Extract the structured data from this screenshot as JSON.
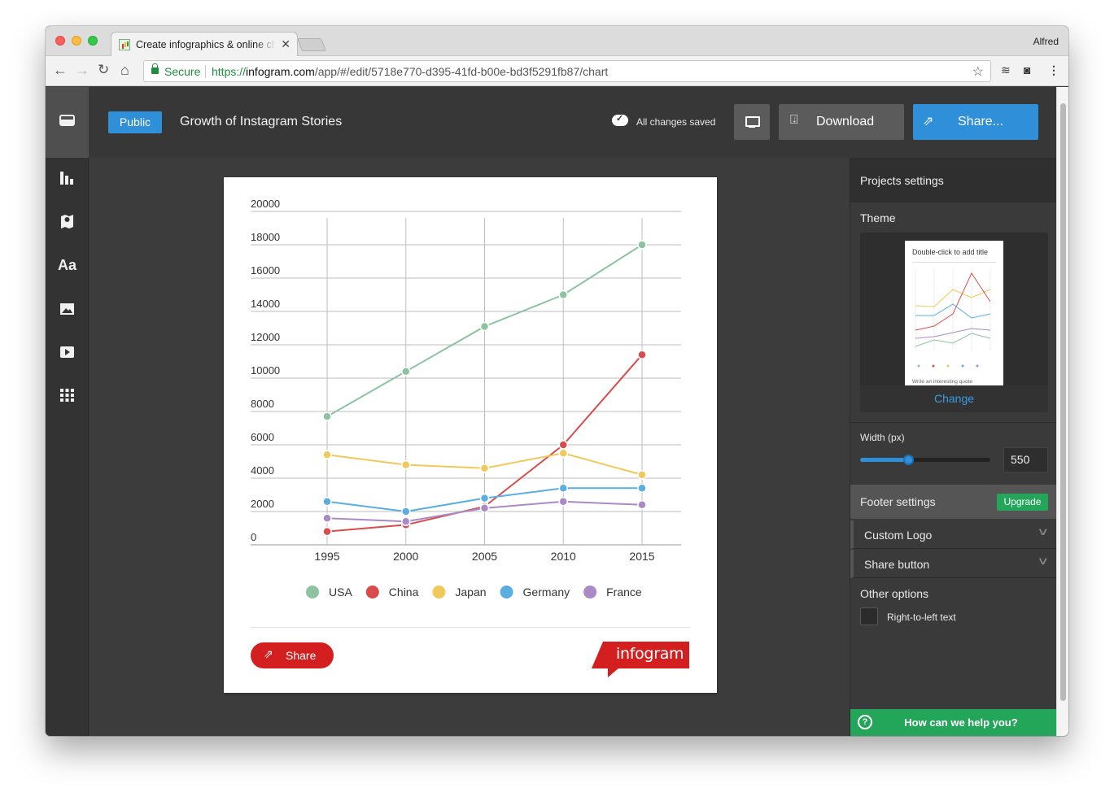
{
  "browser": {
    "tab_title": "Create infographics & online charts",
    "profile": "Alfred",
    "secure_label": "Secure",
    "url_scheme": "https://",
    "url_host": "infogram.com",
    "url_path": "/app/#/edit/5718e770-d395-41fd-b00e-bd3f5291fb87/chart"
  },
  "topbar": {
    "visibility_badge": "Public",
    "title": "Growth of Instagram Stories",
    "save_status": "All changes saved",
    "download_label": "Download",
    "share_label": "Share..."
  },
  "left_rail": {
    "icons": [
      "library-icon",
      "chart-icon",
      "map-icon",
      "text-icon",
      "image-icon",
      "video-icon",
      "grid-icon"
    ]
  },
  "card": {
    "share_label": "Share",
    "brand": "infogram"
  },
  "chart_data": {
    "type": "line",
    "title": "",
    "xlabel": "",
    "ylabel": "",
    "x": [
      1995,
      2000,
      2005,
      2010,
      2015
    ],
    "x_labels": [
      "1995",
      "2000",
      "2005",
      "2010",
      "2015"
    ],
    "ylim": [
      0,
      20000
    ],
    "yticks": [
      0,
      2000,
      4000,
      6000,
      8000,
      10000,
      12000,
      14000,
      16000,
      18000,
      20000
    ],
    "grid": true,
    "legend_position": "bottom",
    "series": [
      {
        "name": "USA",
        "color": "#8dc3a1",
        "values": [
          7700,
          10400,
          13100,
          15000,
          18000
        ]
      },
      {
        "name": "China",
        "color": "#d94c4c",
        "values": [
          800,
          1200,
          2300,
          6000,
          11400
        ]
      },
      {
        "name": "Japan",
        "color": "#f0c95a",
        "values": [
          5400,
          4800,
          4600,
          5500,
          4200
        ]
      },
      {
        "name": "Germany",
        "color": "#5aaee0",
        "values": [
          2600,
          2000,
          2800,
          3400,
          3400
        ]
      },
      {
        "name": "France",
        "color": "#a98ac6",
        "values": [
          1600,
          1400,
          2200,
          2600,
          2400
        ]
      }
    ]
  },
  "panel": {
    "header": "Projects settings",
    "theme_label": "Theme",
    "theme_preview_title": "Double-click to add title",
    "theme_preview_quote": "Write an interesting quote",
    "change_label": "Change",
    "width_label": "Width (px)",
    "width_value": "550",
    "width_slider_fraction": 0.37,
    "footer_label": "Footer settings",
    "upgrade_label": "Upgrade",
    "custom_logo_label": "Custom Logo",
    "share_button_label": "Share button",
    "other_options_label": "Other options",
    "rtl_label": "Right-to-left text",
    "help_label": "How can we help you?"
  },
  "colors": {
    "accent_blue": "#2f8fd8",
    "brand_red": "#d31f1f",
    "help_green": "#23a55a"
  }
}
